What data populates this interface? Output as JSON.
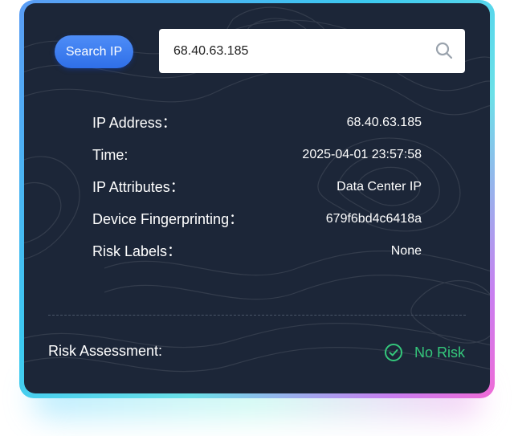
{
  "search": {
    "button_label": "Search IP",
    "input_value": "68.40.63.185",
    "icon": "search-icon"
  },
  "details": [
    {
      "label": "IP Address：",
      "value": "68.40.63.185"
    },
    {
      "label": "Time:",
      "value": "2025-04-01 23:57:58"
    },
    {
      "label": "IP Attributes：",
      "value": "Data Center IP"
    },
    {
      "label": "Device Fingerprinting：",
      "value": "679f6bd4c6418a"
    },
    {
      "label": "Risk Labels：",
      "value": "None"
    }
  ],
  "assessment": {
    "label": "Risk Assessment:",
    "result": "No Risk",
    "result_icon": "check-circle-icon",
    "result_color": "#34c77b"
  },
  "colors": {
    "card_background": "#1c2638",
    "button_accent": "#3a7cf0",
    "border_gradient_start": "#5a9cf5",
    "border_gradient_end": "#f06ad6"
  }
}
